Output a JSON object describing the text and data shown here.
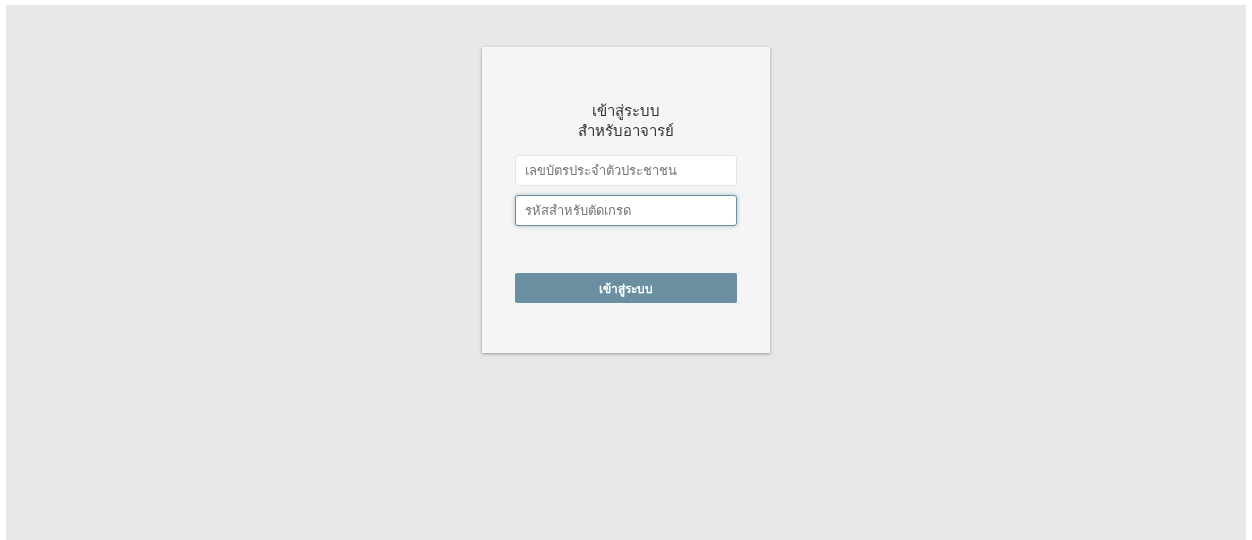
{
  "login_card": {
    "title_lines": [
      "เข้าสู่ระบบ",
      "สำหรับอาจารย์"
    ],
    "fields": [
      {
        "placeholder": "เลขบัตรประจำตัวประชาชน",
        "focused": false
      },
      {
        "placeholder": "รหัสสำหรับตัดเกรด",
        "focused": true
      }
    ],
    "submit_button": "เข้าสู่ระบบ"
  }
}
